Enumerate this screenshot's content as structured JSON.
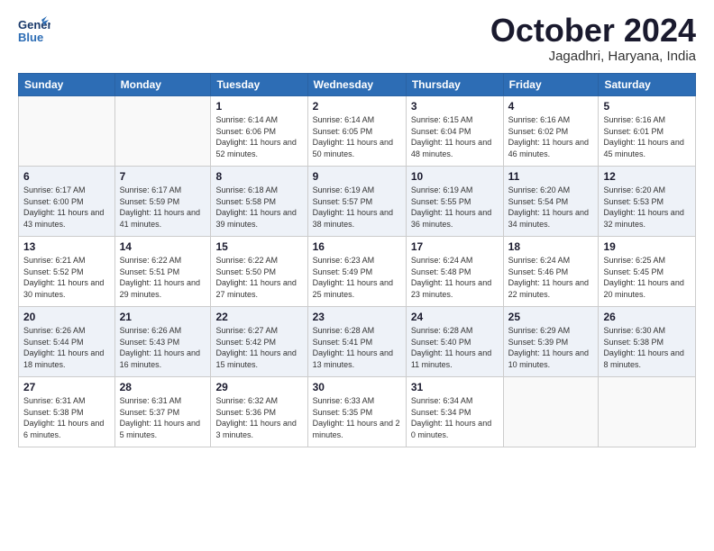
{
  "header": {
    "logo_line1": "General",
    "logo_line2": "Blue",
    "month": "October 2024",
    "location": "Jagadhri, Haryana, India"
  },
  "weekdays": [
    "Sunday",
    "Monday",
    "Tuesday",
    "Wednesday",
    "Thursday",
    "Friday",
    "Saturday"
  ],
  "weeks": [
    [
      {
        "day": "",
        "sunrise": "",
        "sunset": "",
        "daylight": "",
        "empty": true
      },
      {
        "day": "",
        "sunrise": "",
        "sunset": "",
        "daylight": "",
        "empty": true
      },
      {
        "day": "1",
        "sunrise": "Sunrise: 6:14 AM",
        "sunset": "Sunset: 6:06 PM",
        "daylight": "Daylight: 11 hours and 52 minutes."
      },
      {
        "day": "2",
        "sunrise": "Sunrise: 6:14 AM",
        "sunset": "Sunset: 6:05 PM",
        "daylight": "Daylight: 11 hours and 50 minutes."
      },
      {
        "day": "3",
        "sunrise": "Sunrise: 6:15 AM",
        "sunset": "Sunset: 6:04 PM",
        "daylight": "Daylight: 11 hours and 48 minutes."
      },
      {
        "day": "4",
        "sunrise": "Sunrise: 6:16 AM",
        "sunset": "Sunset: 6:02 PM",
        "daylight": "Daylight: 11 hours and 46 minutes."
      },
      {
        "day": "5",
        "sunrise": "Sunrise: 6:16 AM",
        "sunset": "Sunset: 6:01 PM",
        "daylight": "Daylight: 11 hours and 45 minutes."
      }
    ],
    [
      {
        "day": "6",
        "sunrise": "Sunrise: 6:17 AM",
        "sunset": "Sunset: 6:00 PM",
        "daylight": "Daylight: 11 hours and 43 minutes."
      },
      {
        "day": "7",
        "sunrise": "Sunrise: 6:17 AM",
        "sunset": "Sunset: 5:59 PM",
        "daylight": "Daylight: 11 hours and 41 minutes."
      },
      {
        "day": "8",
        "sunrise": "Sunrise: 6:18 AM",
        "sunset": "Sunset: 5:58 PM",
        "daylight": "Daylight: 11 hours and 39 minutes."
      },
      {
        "day": "9",
        "sunrise": "Sunrise: 6:19 AM",
        "sunset": "Sunset: 5:57 PM",
        "daylight": "Daylight: 11 hours and 38 minutes."
      },
      {
        "day": "10",
        "sunrise": "Sunrise: 6:19 AM",
        "sunset": "Sunset: 5:55 PM",
        "daylight": "Daylight: 11 hours and 36 minutes."
      },
      {
        "day": "11",
        "sunrise": "Sunrise: 6:20 AM",
        "sunset": "Sunset: 5:54 PM",
        "daylight": "Daylight: 11 hours and 34 minutes."
      },
      {
        "day": "12",
        "sunrise": "Sunrise: 6:20 AM",
        "sunset": "Sunset: 5:53 PM",
        "daylight": "Daylight: 11 hours and 32 minutes."
      }
    ],
    [
      {
        "day": "13",
        "sunrise": "Sunrise: 6:21 AM",
        "sunset": "Sunset: 5:52 PM",
        "daylight": "Daylight: 11 hours and 30 minutes."
      },
      {
        "day": "14",
        "sunrise": "Sunrise: 6:22 AM",
        "sunset": "Sunset: 5:51 PM",
        "daylight": "Daylight: 11 hours and 29 minutes."
      },
      {
        "day": "15",
        "sunrise": "Sunrise: 6:22 AM",
        "sunset": "Sunset: 5:50 PM",
        "daylight": "Daylight: 11 hours and 27 minutes."
      },
      {
        "day": "16",
        "sunrise": "Sunrise: 6:23 AM",
        "sunset": "Sunset: 5:49 PM",
        "daylight": "Daylight: 11 hours and 25 minutes."
      },
      {
        "day": "17",
        "sunrise": "Sunrise: 6:24 AM",
        "sunset": "Sunset: 5:48 PM",
        "daylight": "Daylight: 11 hours and 23 minutes."
      },
      {
        "day": "18",
        "sunrise": "Sunrise: 6:24 AM",
        "sunset": "Sunset: 5:46 PM",
        "daylight": "Daylight: 11 hours and 22 minutes."
      },
      {
        "day": "19",
        "sunrise": "Sunrise: 6:25 AM",
        "sunset": "Sunset: 5:45 PM",
        "daylight": "Daylight: 11 hours and 20 minutes."
      }
    ],
    [
      {
        "day": "20",
        "sunrise": "Sunrise: 6:26 AM",
        "sunset": "Sunset: 5:44 PM",
        "daylight": "Daylight: 11 hours and 18 minutes."
      },
      {
        "day": "21",
        "sunrise": "Sunrise: 6:26 AM",
        "sunset": "Sunset: 5:43 PM",
        "daylight": "Daylight: 11 hours and 16 minutes."
      },
      {
        "day": "22",
        "sunrise": "Sunrise: 6:27 AM",
        "sunset": "Sunset: 5:42 PM",
        "daylight": "Daylight: 11 hours and 15 minutes."
      },
      {
        "day": "23",
        "sunrise": "Sunrise: 6:28 AM",
        "sunset": "Sunset: 5:41 PM",
        "daylight": "Daylight: 11 hours and 13 minutes."
      },
      {
        "day": "24",
        "sunrise": "Sunrise: 6:28 AM",
        "sunset": "Sunset: 5:40 PM",
        "daylight": "Daylight: 11 hours and 11 minutes."
      },
      {
        "day": "25",
        "sunrise": "Sunrise: 6:29 AM",
        "sunset": "Sunset: 5:39 PM",
        "daylight": "Daylight: 11 hours and 10 minutes."
      },
      {
        "day": "26",
        "sunrise": "Sunrise: 6:30 AM",
        "sunset": "Sunset: 5:38 PM",
        "daylight": "Daylight: 11 hours and 8 minutes."
      }
    ],
    [
      {
        "day": "27",
        "sunrise": "Sunrise: 6:31 AM",
        "sunset": "Sunset: 5:38 PM",
        "daylight": "Daylight: 11 hours and 6 minutes."
      },
      {
        "day": "28",
        "sunrise": "Sunrise: 6:31 AM",
        "sunset": "Sunset: 5:37 PM",
        "daylight": "Daylight: 11 hours and 5 minutes."
      },
      {
        "day": "29",
        "sunrise": "Sunrise: 6:32 AM",
        "sunset": "Sunset: 5:36 PM",
        "daylight": "Daylight: 11 hours and 3 minutes."
      },
      {
        "day": "30",
        "sunrise": "Sunrise: 6:33 AM",
        "sunset": "Sunset: 5:35 PM",
        "daylight": "Daylight: 11 hours and 2 minutes."
      },
      {
        "day": "31",
        "sunrise": "Sunrise: 6:34 AM",
        "sunset": "Sunset: 5:34 PM",
        "daylight": "Daylight: 11 hours and 0 minutes."
      },
      {
        "day": "",
        "sunrise": "",
        "sunset": "",
        "daylight": "",
        "empty": true
      },
      {
        "day": "",
        "sunrise": "",
        "sunset": "",
        "daylight": "",
        "empty": true
      }
    ]
  ]
}
